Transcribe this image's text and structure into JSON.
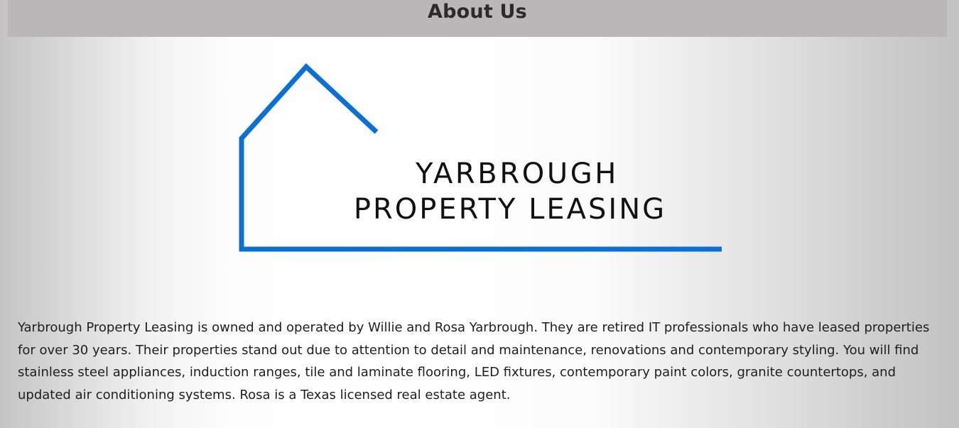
{
  "header": {
    "title": "About Us"
  },
  "logo": {
    "line1": "YARBROUGH",
    "line2": "PROPERTY LEASING",
    "house_color": "#0a6fd6",
    "text_color": "#111111"
  },
  "about": {
    "paragraph": "Yarbrough Property Leasing is owned and operated by Willie and Rosa Yarbrough. They are retired IT professionals who have leased properties for over 30 years. Their properties stand out due to attention to detail and maintenance, renovations and contemporary styling. You will find stainless steel appliances, induction ranges, tile and laminate flooring, LED fixtures, contemporary paint colors, granite countertops, and updated air conditioning systems. Rosa is a Texas licensed real estate agent."
  },
  "colors": {
    "header_bar": "#b9b7b8",
    "header_text": "#2b2b2b",
    "body_text": "#1e1e1e"
  }
}
